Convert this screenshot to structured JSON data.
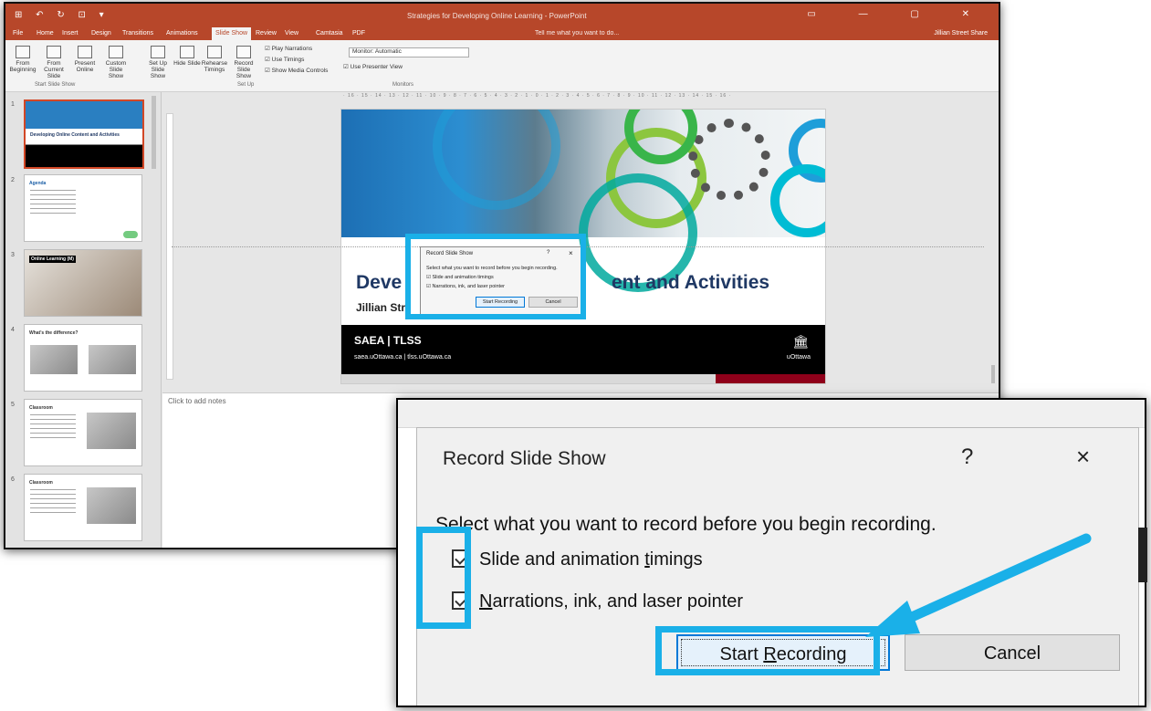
{
  "ppt": {
    "quick_access": "⊞ ↶ ↻ ⊡ ▾",
    "doc_title": "Strategies for Developing Online Learning - PowerPoint",
    "window_controls": "▭ — ▢ ✕",
    "tabs": [
      "File",
      "Home",
      "Insert",
      "Design",
      "Transitions",
      "Animations",
      "Slide Show",
      "Review",
      "View",
      "Camtasia",
      "PDF"
    ],
    "active_tab": "Slide Show",
    "tell_me": "Tell me what you want to do...",
    "user": "Jillian Street  Share",
    "ribbon": {
      "from_beginning": "From Beginning",
      "from_current": "From Current Slide",
      "present_online": "Present Online",
      "custom_show": "Custom Slide Show",
      "setup": "Set Up Slide Show",
      "hide_slide": "Hide Slide",
      "rehearse": "Rehearse Timings",
      "record": "Record Slide Show",
      "play_narrations": "Play Narrations",
      "use_timings": "Use Timings",
      "show_media": "Show Media Controls",
      "monitor": "Monitor: Automatic",
      "presenter_view": "Use Presenter View",
      "group_start": "Start Slide Show",
      "group_setup": "Set Up",
      "group_monitors": "Monitors"
    },
    "thumbs": [
      {
        "num": "1",
        "title": "Developing Online Content and Activities"
      },
      {
        "num": "2",
        "title": "Agenda"
      },
      {
        "num": "3",
        "title": "Online Learning (M)"
      },
      {
        "num": "4",
        "title": "What's the difference?"
      },
      {
        "num": "5",
        "title": "Classroom"
      },
      {
        "num": "6",
        "title": "Classroom"
      }
    ],
    "notes_placeholder": "Click to add notes",
    "slide": {
      "title_start": "Deve",
      "title_end": "ent and Activities",
      "subtitle": "Jillian Str",
      "brand": "SAEA | TLSS",
      "urls": "saea.uOttawa.ca | tlss.uOttawa.ca",
      "logo_text": "uOttawa"
    }
  },
  "dialog": {
    "title": "Record Slide Show",
    "help": "?",
    "close": "×",
    "instruction": "Select what you want to record before you begin recording.",
    "option1_pre": "Slide and animation ",
    "option1_accel": "t",
    "option1_post": "imings",
    "option2_accel": "N",
    "option2_post": "arrations, ink, and laser pointer",
    "start_pre": "Start ",
    "start_accel": "R",
    "start_post": "ecording",
    "cancel": "Cancel",
    "option1_checked": true,
    "option2_checked": true
  },
  "mini_dialog": {
    "title": "Record Slide Show",
    "help": "?",
    "close": "×",
    "instruction": "Select what you want to record before you begin recording.",
    "option1": "Slide and animation timings",
    "option2": "Narrations, ink, and laser pointer",
    "start": "Start Recording",
    "cancel": "Cancel"
  },
  "colors": {
    "highlight": "#1ab0e8",
    "ppt_accent": "#b7472a",
    "start_border": "#0078d7"
  }
}
